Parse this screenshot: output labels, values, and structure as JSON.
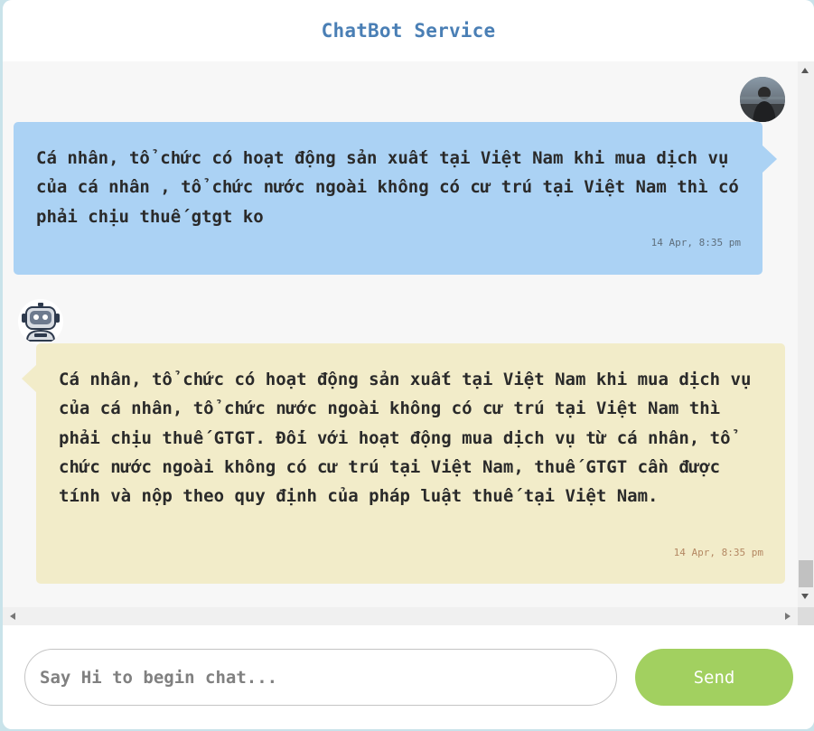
{
  "header": {
    "title": "ChatBot Service"
  },
  "messages": [
    {
      "role": "user",
      "text": "Cá nhân, tổ chức có hoạt động sản xuất tại Việt Nam khi mua dịch vụ của cá nhân , tổ chức nước ngoài không có cư trú tại Việt Nam thì có phải chịu thuế gtgt ko",
      "time": "14 Apr, 8:35 pm"
    },
    {
      "role": "bot",
      "text": "Cá nhân, tổ chức có hoạt động sản xuất tại Việt Nam khi mua dịch vụ của cá nhân, tổ chức nước ngoài không có cư trú tại Việt Nam thì phải chịu thuế GTGT. Đối với hoạt động mua dịch vụ từ cá nhân, tổ chức nước ngoài không có cư trú tại Việt Nam, thuế GTGT cần được tính và nộp theo quy định của pháp luật thuế tại Việt Nam.",
      "time": "14 Apr, 8:35 pm"
    }
  ],
  "composer": {
    "placeholder": "Say Hi to begin chat...",
    "send_label": "Send"
  },
  "icons": {
    "user_avatar": "user-avatar-photo",
    "bot_avatar": "robot-icon"
  },
  "colors": {
    "title": "#4a7fb5",
    "user_bubble": "#abd2f4",
    "bot_bubble": "#f2ecc9",
    "send_button": "#a2d060"
  }
}
